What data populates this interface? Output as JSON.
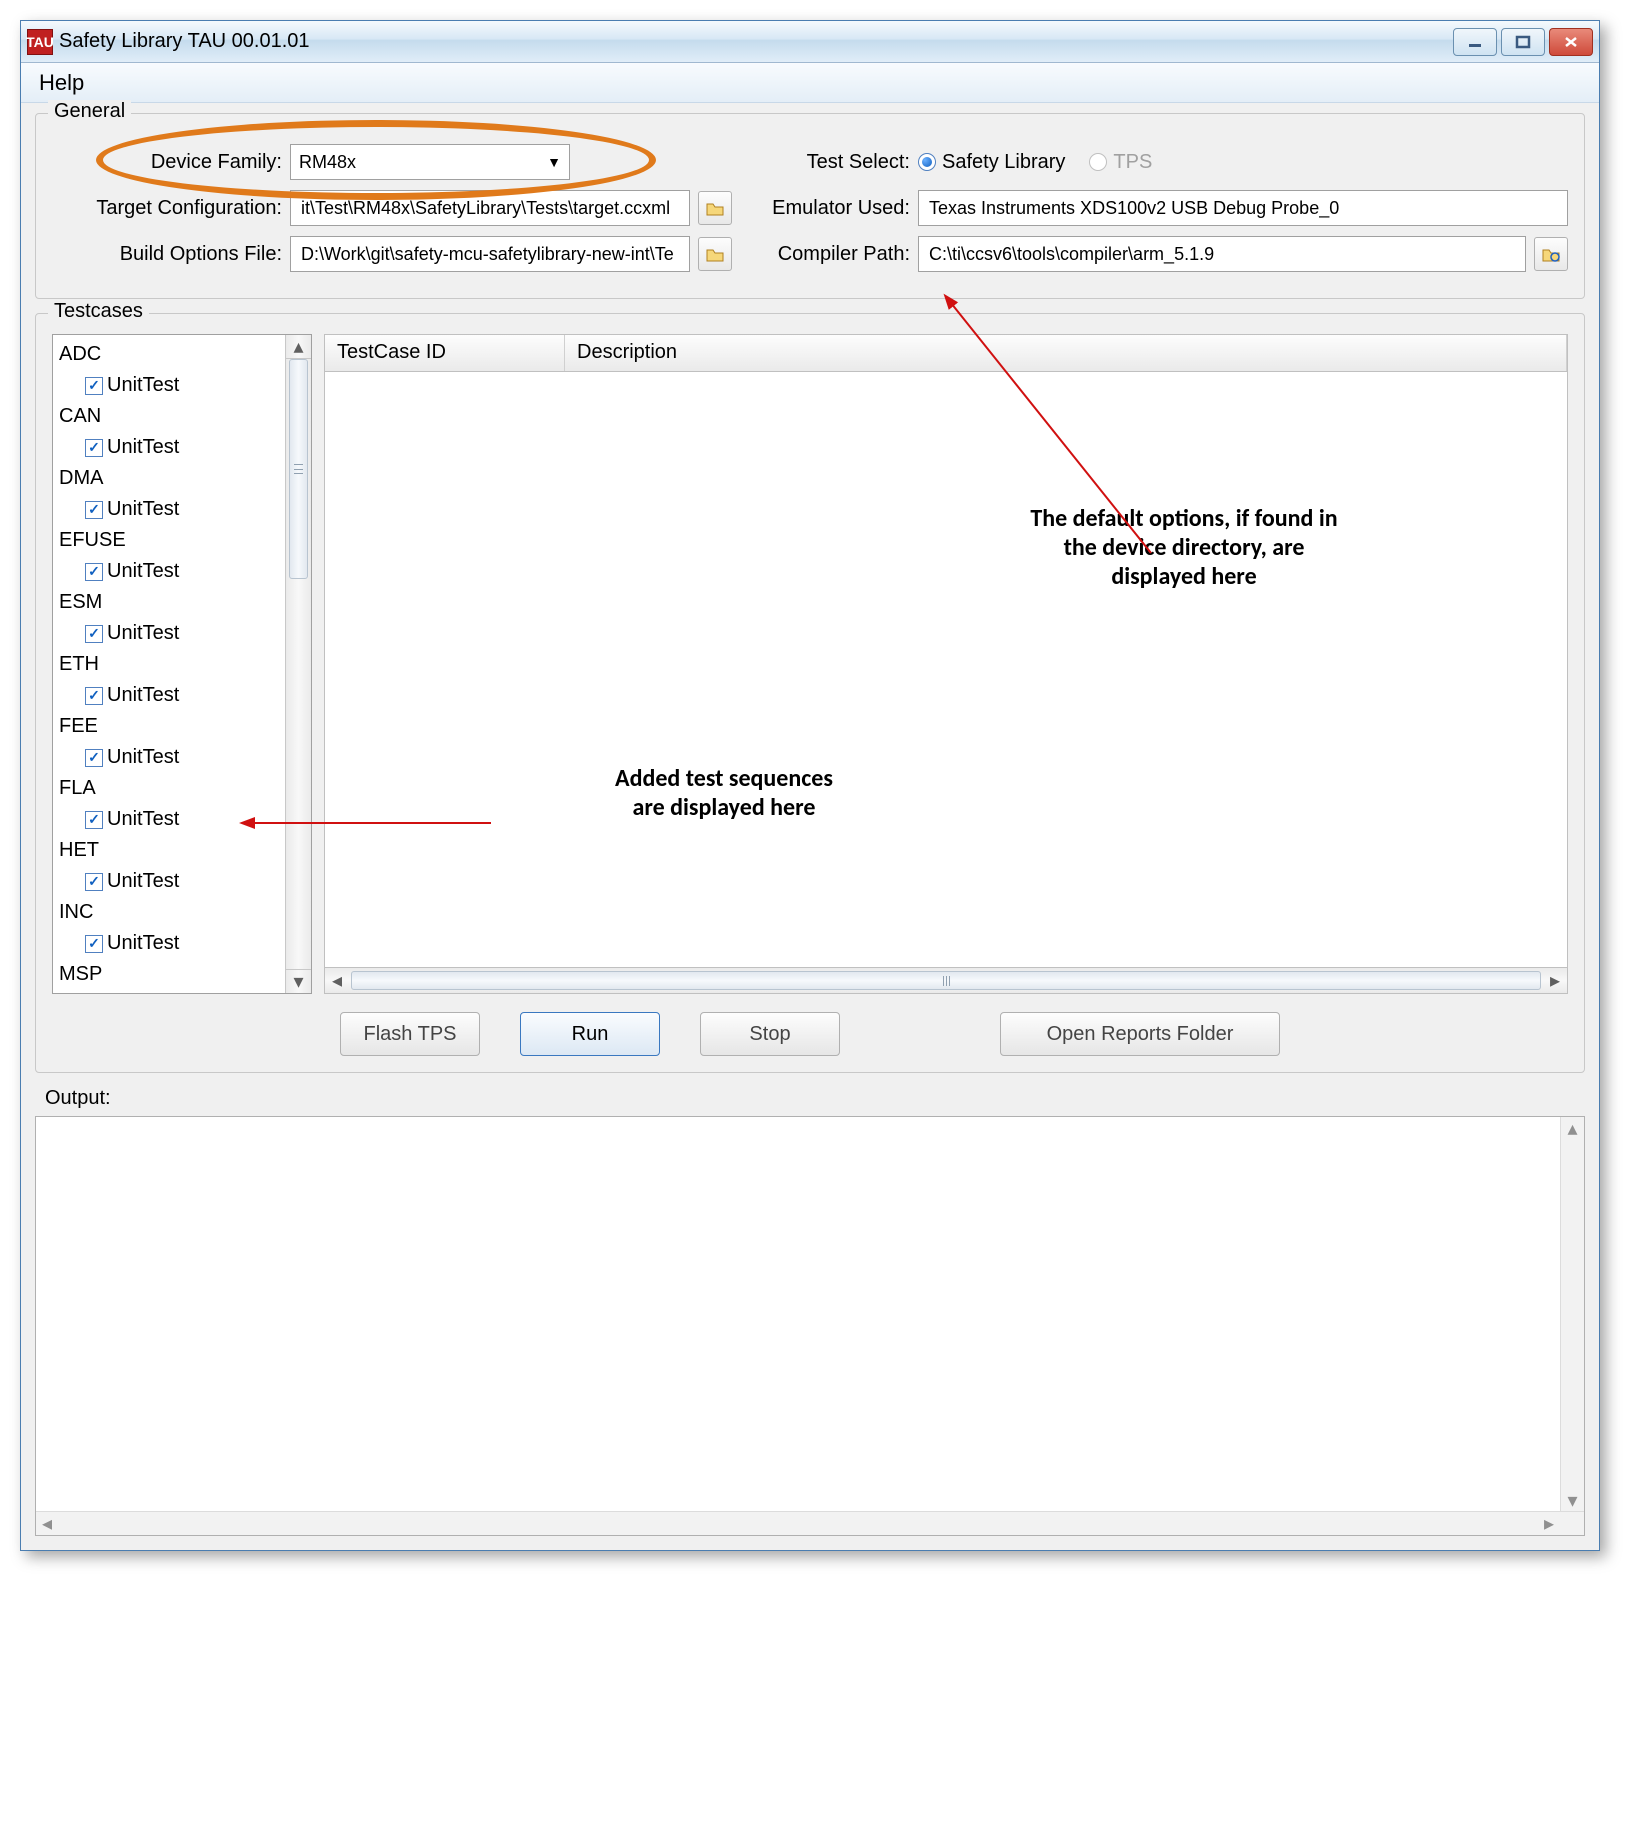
{
  "window": {
    "title": "Safety Library TAU 00.01.01",
    "icon_text": "TAU"
  },
  "menu": {
    "help": "Help"
  },
  "general": {
    "title": "General",
    "device_family_label": "Device Family:",
    "device_family_value": "RM48x",
    "test_select_label": "Test Select:",
    "radio_safety": "Safety Library",
    "radio_tps": "TPS",
    "target_config_label": "Target Configuration:",
    "target_config_value": "it\\Test\\RM48x\\SafetyLibrary\\Tests\\target.ccxml",
    "emulator_label": "Emulator Used:",
    "emulator_value": "Texas Instruments XDS100v2 USB Debug Probe_0",
    "build_options_label": "Build Options File:",
    "build_options_value": "D:\\Work\\git\\safety-mcu-safetylibrary-new-int\\Te",
    "compiler_label": "Compiler Path:",
    "compiler_value": "C:\\ti\\ccsv6\\tools\\compiler\\arm_5.1.9"
  },
  "testcases": {
    "title": "Testcases",
    "col_id": "TestCase ID",
    "col_desc": "Description",
    "tree": [
      {
        "cat": "ADC",
        "leaf": "UnitTest",
        "checked": true
      },
      {
        "cat": "CAN",
        "leaf": "UnitTest",
        "checked": true
      },
      {
        "cat": "DMA",
        "leaf": "UnitTest",
        "checked": true
      },
      {
        "cat": "EFUSE",
        "leaf": "UnitTest",
        "checked": true
      },
      {
        "cat": "ESM",
        "leaf": "UnitTest",
        "checked": true
      },
      {
        "cat": "ETH",
        "leaf": "UnitTest",
        "checked": true
      },
      {
        "cat": "FEE",
        "leaf": "UnitTest",
        "checked": true
      },
      {
        "cat": "FLA",
        "leaf": "UnitTest",
        "checked": true
      },
      {
        "cat": "HET",
        "leaf": "UnitTest",
        "checked": true
      },
      {
        "cat": "INC",
        "leaf": "UnitTest",
        "checked": true
      },
      {
        "cat": "MSP",
        "leaf": "",
        "checked": false
      }
    ]
  },
  "buttons": {
    "flash_tps": "Flash TPS",
    "run": "Run",
    "stop": "Stop",
    "open_reports": "Open Reports Folder"
  },
  "output_label": "Output:",
  "annotations": {
    "a1_l1": "Added test sequences are",
    "a1_l2": "are displayed here",
    "a1_full_l1": "Added test sequences",
    "a2_l1": "The default options, if found in",
    "a2_l2": "the device directory, are",
    "a2_l3": "displayed here"
  }
}
